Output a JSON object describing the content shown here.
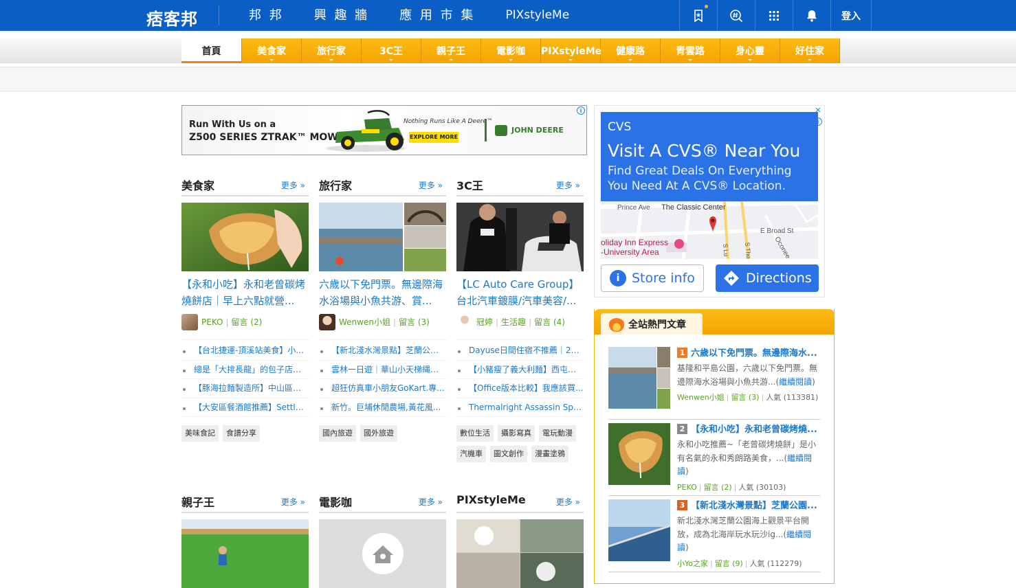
{
  "topbar": {
    "logo": "痞客邦",
    "nav": [
      "邦 邦",
      "興 趣 牆",
      "應 用 市 集",
      "PIXstyleMe"
    ],
    "icons": [
      "bookmark-star-icon",
      "hashtag-search-icon",
      "apps-grid-icon",
      "bell-icon"
    ],
    "login": "登入",
    "accent": "#0b5ec6"
  },
  "categories": [
    "首頁",
    "美食家",
    "旅行家",
    "3C王",
    "親子王",
    "電影咖",
    "PIXstyleMe",
    "健康路",
    "青雲路",
    "身心靈",
    "好住家"
  ],
  "ad_banner": {
    "line1": "Run With Us on a",
    "line2": "Z500 SERIES ZTRAK™ MOWER",
    "slogan": "Nothing Runs Like A Deere™",
    "cta": "EXPLORE MORE",
    "brand": "JOHN DEERE"
  },
  "columns": [
    {
      "title": "美食家",
      "more": "更多 »",
      "article": "【永和小吃】永和老曾碳烤燒餅店｜早上六點就營...",
      "author": "PEKO",
      "comments": "留言 (2)",
      "board": "",
      "list": [
        "【台北捷運-頂溪站美食】小...",
        "總是「大排長龍」的包子店！...",
        "【豚海拉麵製造所】中山區拉...",
        "【大安區餐酒館推薦】Settle ..."
      ],
      "tags": [
        "美味食記",
        "食譜分享"
      ]
    },
    {
      "title": "旅行家",
      "more": "更多 »",
      "article": "六歲以下免門票。無邊際海水浴場與小魚共游、賞...",
      "author": "Wenwen小姐",
      "comments": "留言 (3)",
      "board": "",
      "list": [
        "【新北淺水灣景點】芝蘭公園...",
        "雲林一日遊｜華山小天梯縄索...",
        "超狂仿真車小朋友GoKart.專...",
        "新竹。巨埔休閒農場,黃花風..."
      ],
      "tags": [
        "國內旅遊",
        "國外旅遊"
      ]
    },
    {
      "title": "3C王",
      "more": "更多 »",
      "article": "【LC Auto Care Group】台北汽車鍍膜/汽車美容/...",
      "author": "冠婷",
      "comments": "留言 (4)",
      "board": "生活趣",
      "list": [
        "Dayuse日間住宿不推薦｜20...",
        "【小豬瘦了義大利麵】西屯緊...",
        "【Office版本比較】我應該買...",
        "Thermalright Assassin Spirit ..."
      ],
      "tags": [
        "數位生活",
        "攝影寫真",
        "電玩動漫",
        "汽機車",
        "圖文創作",
        "漫畫塗鴉"
      ]
    },
    {
      "title": "親子王",
      "more": "更多 »"
    },
    {
      "title": "電影咖",
      "more": "更多 »"
    },
    {
      "title": "PIXstyleMe",
      "more": "更多 »"
    }
  ],
  "side_ad": {
    "brand": "CVS",
    "headline": "Visit A CVS® Near You",
    "sub": "Find Great Deals On Everything You Need At A CVS® Location.",
    "map_labels": [
      "Prince Ave",
      "The Classic Center",
      "E Broad St",
      "oliday Inn Express",
      "-University Area",
      "Oconee",
      "S Thomas",
      "S Lu"
    ],
    "store_info": "Store info",
    "directions": "Directions"
  },
  "hot": {
    "title": "全站熱門文章",
    "hot_badge": "HOT",
    "items": [
      {
        "rank": "1",
        "rank_color": "#f47a1f",
        "title": "六歲以下免門票。無邊際海水...",
        "desc": "基隆和平島公園，六歲以下免門票。無邊際海水浴場與小魚共游...",
        "more": "繼續閱讀",
        "author": "Wenwen小姐",
        "comments": "留言 (3)",
        "pop": "人氣 (113381)"
      },
      {
        "rank": "2",
        "rank_color": "#888888",
        "title": "【永和小吃】永和老曾碳烤燒...",
        "desc": "永和小吃推薦~「老曾碳烤燒餅」是小有名氣的永和秀朗路美食，...",
        "more": "繼續閱讀",
        "author": "PEKO",
        "comments": "留言 (2)",
        "pop": "人氣 (30103)"
      },
      {
        "rank": "3",
        "rank_color": "#e06020",
        "title": "【新北淺水灣景點】芝蘭公園...",
        "desc": "新北淺水灣芝蘭公園海上觀景平台開放，成為北海岸玩水玩沙ig...",
        "more": "繼續閱讀",
        "author": "小Yo之家",
        "comments": "留言 (9)",
        "pop": "人氣 (112279)"
      }
    ]
  }
}
